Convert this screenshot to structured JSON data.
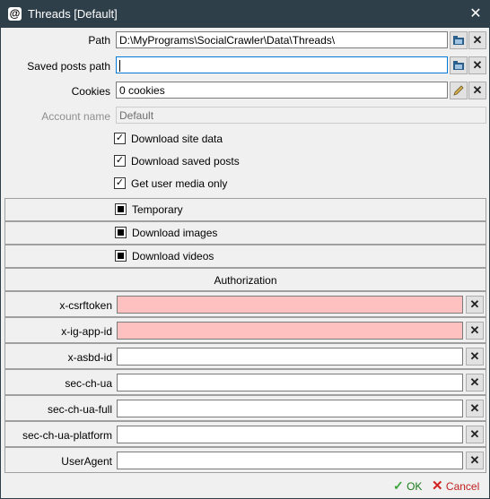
{
  "window": {
    "title": "Threads [Default]"
  },
  "settings": {
    "path_label": "Path",
    "path_value": "D:\\MyPrograms\\SocialCrawler\\Data\\Threads\\",
    "saved_posts_label": "Saved posts path",
    "saved_posts_value": "",
    "cookies_label": "Cookies",
    "cookies_value": "0 cookies",
    "account_label": "Account name",
    "account_value": "Default"
  },
  "checks": [
    {
      "label": "Download site data",
      "checked": true
    },
    {
      "label": "Download saved posts",
      "checked": true
    },
    {
      "label": "Get user media only",
      "checked": true
    }
  ],
  "options": [
    {
      "label": "Temporary",
      "state": "indeterminate"
    },
    {
      "label": "Download images",
      "state": "indeterminate"
    },
    {
      "label": "Download videos",
      "state": "indeterminate"
    }
  ],
  "authorization": {
    "header": "Authorization",
    "fields": [
      {
        "label": "x-csrftoken",
        "value": "",
        "invalid": true
      },
      {
        "label": "x-ig-app-id",
        "value": "",
        "invalid": true
      },
      {
        "label": "x-asbd-id",
        "value": "",
        "invalid": false
      },
      {
        "label": "sec-ch-ua",
        "value": "",
        "invalid": false
      },
      {
        "label": "sec-ch-ua-full",
        "value": "",
        "invalid": false
      },
      {
        "label": "sec-ch-ua-platform",
        "value": "",
        "invalid": false
      },
      {
        "label": "UserAgent",
        "value": "",
        "invalid": false
      }
    ]
  },
  "footer": {
    "ok_label": "OK",
    "cancel_label": "Cancel"
  },
  "icons": {
    "app": "threads-logo-icon",
    "close": "close-icon",
    "folder": "folder-icon",
    "edit": "pencil-icon",
    "clear": "clear-icon"
  }
}
